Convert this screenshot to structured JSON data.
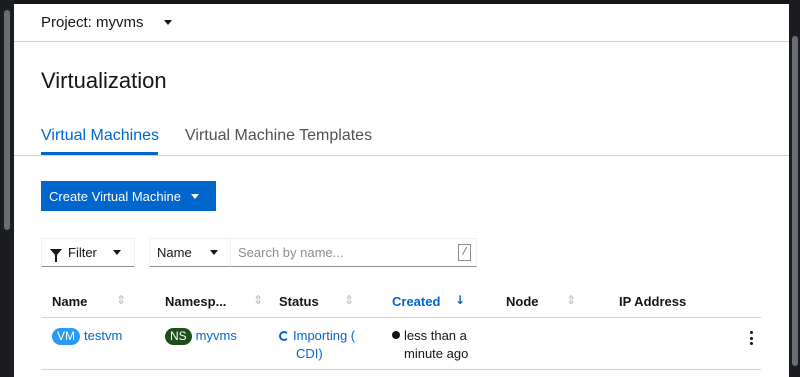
{
  "project": {
    "label": "Project: myvms"
  },
  "page_title": "Virtualization",
  "tabs": [
    {
      "label": "Virtual Machines",
      "active": true
    },
    {
      "label": "Virtual Machine Templates",
      "active": false
    }
  ],
  "create_button": {
    "label": "Create Virtual Machine"
  },
  "filter": {
    "label": "Filter",
    "attribute_select": "Name",
    "search_placeholder": "Search by name...",
    "shortcut_key": "/"
  },
  "table": {
    "columns": [
      {
        "label": "Name",
        "sortable": true,
        "sorted": false
      },
      {
        "label": "Namesp...",
        "sortable": true,
        "sorted": false
      },
      {
        "label": "Status",
        "sortable": true,
        "sorted": false
      },
      {
        "label": "Created",
        "sortable": true,
        "sorted": true
      },
      {
        "label": "Node",
        "sortable": true,
        "sorted": false
      },
      {
        "label": "IP Address",
        "sortable": false,
        "sorted": false
      }
    ],
    "sort_icons": {
      "unsorted": "⇕",
      "sorted_desc": "↓"
    },
    "rows": [
      {
        "name_badge": "VM",
        "name": "testvm",
        "namespace_badge": "NS",
        "namespace": "myvms",
        "status_line1": "Importing (",
        "status_line2": "CDI)",
        "created_line1": "less than a",
        "created_line2": "minute ago",
        "node": "",
        "ip_address": ""
      }
    ]
  },
  "colors": {
    "accent": "#0066cc",
    "vm_badge": "#2b9af3",
    "ns_badge": "#1e4f18",
    "frame": "#151515"
  },
  "icons": {
    "project_dropdown": "caret-down-icon",
    "filter": "filter-icon",
    "status": "in-progress-icon",
    "created": "globe-icon",
    "row_actions": "kebab-icon"
  }
}
